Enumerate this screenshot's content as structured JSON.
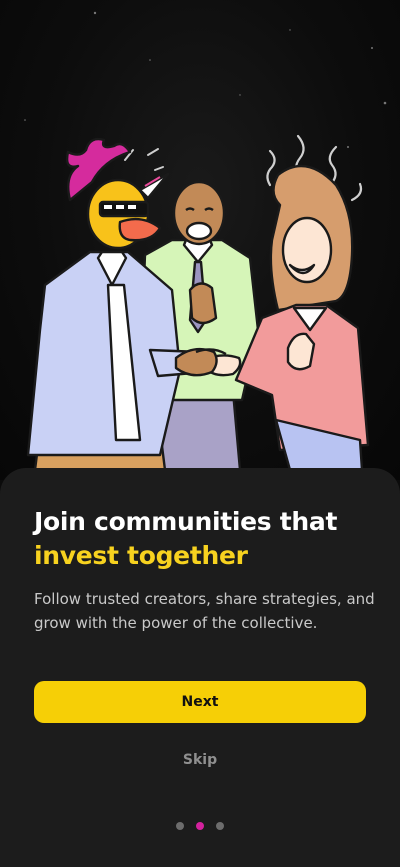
{
  "onboarding": {
    "title_line1": "Join communities that",
    "title_line2": "invest together",
    "subtitle": "Follow trusted creators, share strategies, and grow with the power of the collective.",
    "next_label": "Next",
    "skip_label": "Skip",
    "pagination": {
      "total": 3,
      "active_index": 1
    }
  },
  "colors": {
    "accent": "#f6cf06",
    "highlight_text": "#f7d21f",
    "active_dot": "#d3219d",
    "background": "#0b0b0b",
    "sheet": "#1c1c1c"
  },
  "illustration": {
    "icon": "community-handshake-illustration"
  }
}
